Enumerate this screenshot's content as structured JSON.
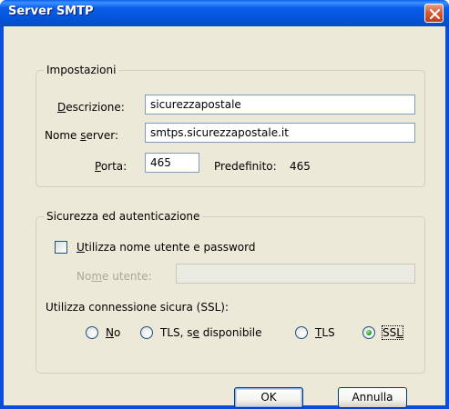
{
  "window": {
    "title": "Server SMTP"
  },
  "settings_group": {
    "legend": "Impostazioni",
    "description": {
      "label": "Descrizione:",
      "value": "sicurezzapostale"
    },
    "server_name": {
      "label": "Nome server:",
      "value": "smtps.sicurezzapostale.it"
    },
    "port": {
      "label": "Porta:",
      "value": "465",
      "default_label": "Predefinito:",
      "default_value": "465"
    }
  },
  "security_group": {
    "legend": "Sicurezza ed autenticazione",
    "use_auth": {
      "label": "Utilizza nome utente e password",
      "checked": false
    },
    "username": {
      "label": "Nome utente:",
      "value": ""
    },
    "ssl_label": "Utilizza connessione sicura (SSL):",
    "options": [
      {
        "label": "No",
        "checked": false
      },
      {
        "label": "TLS, se disponibile",
        "checked": false
      },
      {
        "label": "TLS",
        "checked": false
      },
      {
        "label": "SSL",
        "checked": true
      }
    ]
  },
  "buttons": {
    "ok": "OK",
    "cancel": "Annulla"
  }
}
